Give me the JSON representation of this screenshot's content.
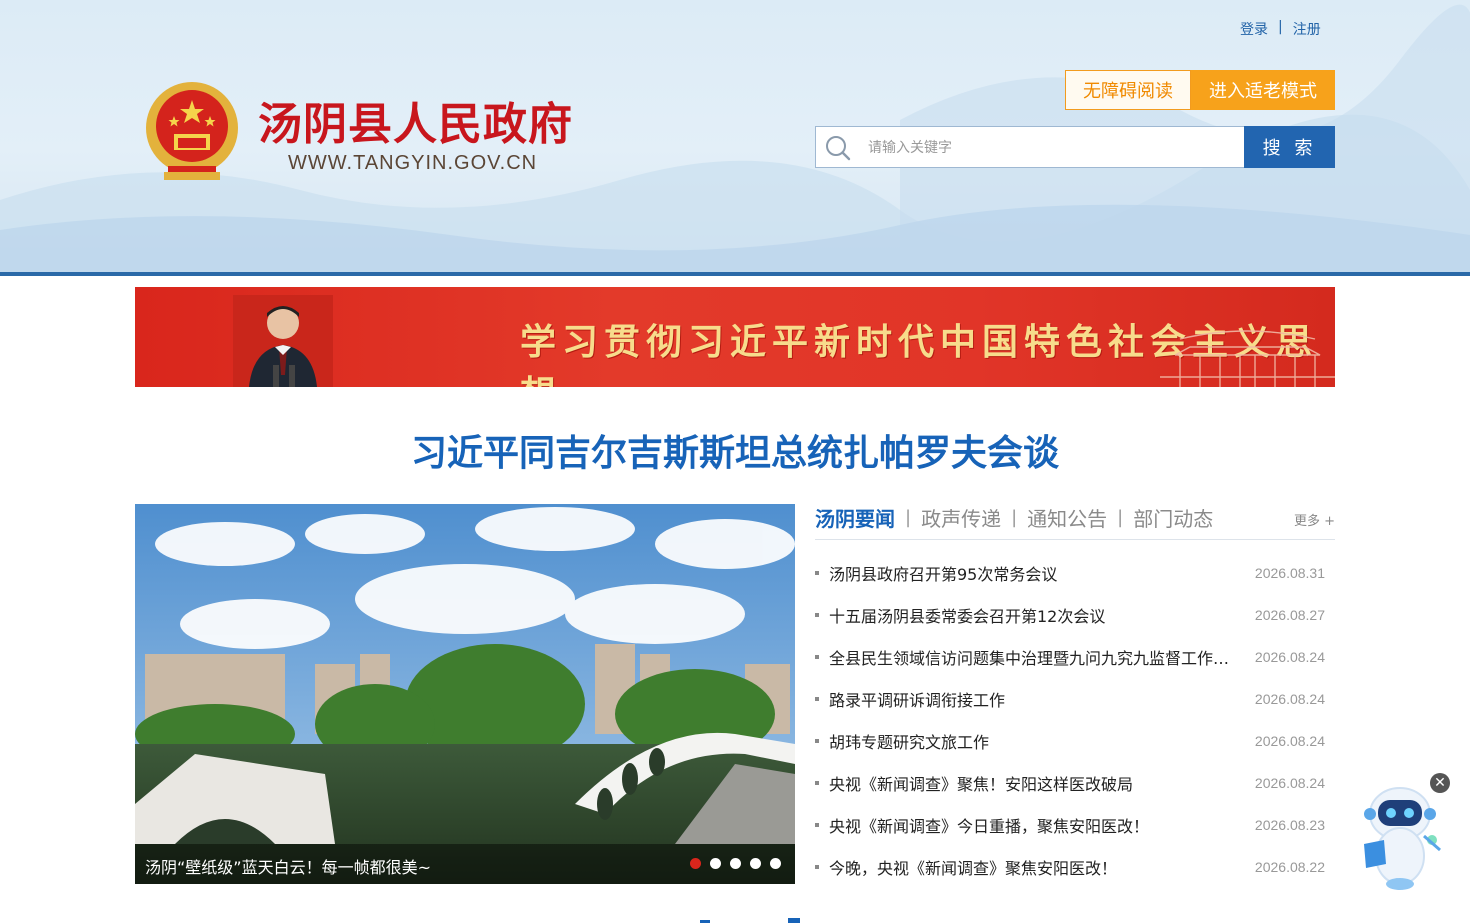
{
  "header": {
    "login": "登录",
    "separator": "|",
    "register": "注册",
    "site_title": "汤阴县人民政府",
    "site_url": "WWW.TANGYIN.GOV.CN",
    "accessible_btn": "无障碍阅读",
    "elder_btn": "进入适老模式",
    "search_placeholder": "请输入关键字",
    "search_btn": "搜 索"
  },
  "banner": {
    "slogan": "学习贯彻习近平新时代中国特色社会主义思想"
  },
  "headline": "习近平同吉尔吉斯斯坦总统扎帕罗夫会谈",
  "slideshow": {
    "caption": "汤阴“壁纸级”蓝天白云！每一帧都很美~",
    "dot_count": 5,
    "active_dot": 0
  },
  "news": {
    "tabs": [
      {
        "label": "汤阴要闻"
      },
      {
        "label": "政声传递"
      },
      {
        "label": "通知公告"
      },
      {
        "label": "部门动态"
      }
    ],
    "more": "更多 +",
    "items": [
      {
        "title": "汤阴县政府召开第95次常务会议",
        "date": "2026.08.31"
      },
      {
        "title": "十五届汤阴县委常委会召开第12次会议",
        "date": "2026.08.27"
      },
      {
        "title": "全县民生领域信访问题集中治理暨九问九究九监督工作…",
        "date": "2026.08.24"
      },
      {
        "title": "路录平调研诉调衔接工作",
        "date": "2026.08.24"
      },
      {
        "title": "胡玮专题研究文旅工作",
        "date": "2026.08.24"
      },
      {
        "title": "央视《新闻调查》聚焦！安阳这样医改破局",
        "date": "2026.08.24"
      },
      {
        "title": "央视《新闻调查》今日重播，聚焦安阳医改！",
        "date": "2026.08.23"
      },
      {
        "title": "今晚，央视《新闻调查》聚焦安阳医改！",
        "date": "2026.08.22"
      }
    ]
  },
  "widgets": {
    "close_glyph": "✕"
  },
  "colors": {
    "brand_red": "#c8161d",
    "brand_blue": "#1763b8",
    "accent_orange": "#f7a21b"
  }
}
